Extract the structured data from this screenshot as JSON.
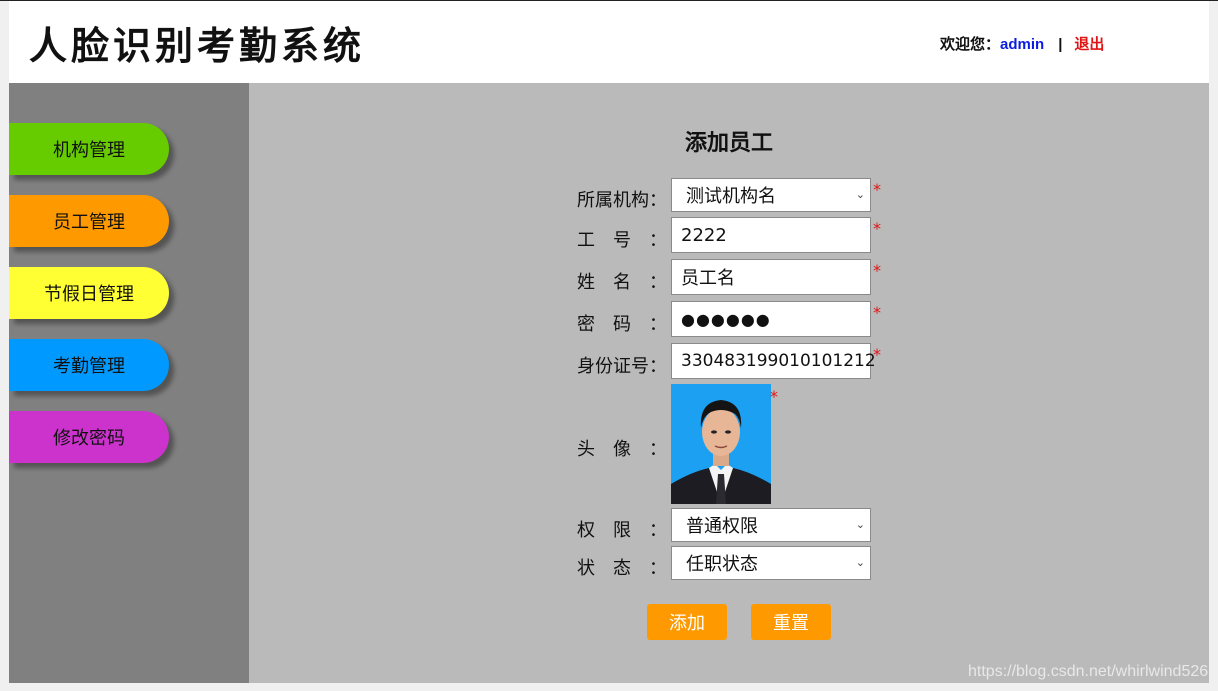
{
  "header": {
    "logo_text": "人脸识别考勤系统",
    "welcome": "欢迎您：",
    "username": "admin",
    "separator": "|",
    "logout": "退出"
  },
  "sidebar": {
    "items": [
      {
        "label": "机构管理",
        "color": "#66cc00"
      },
      {
        "label": "员工管理",
        "color": "#ff9900"
      },
      {
        "label": "节假日管理",
        "color": "#ffff33"
      },
      {
        "label": "考勤管理",
        "color": "#0099ff"
      },
      {
        "label": "修改密码",
        "color": "#cc33cc"
      }
    ]
  },
  "form": {
    "title": "添加员工",
    "org_label": "所属机构：",
    "org_value": "测试机构名",
    "empno_label": "工号：",
    "empno_value": "2222",
    "name_label": "姓名：",
    "name_value": "员工名",
    "password_label": "密码：",
    "password_value": "●●●●●●",
    "idcard_label": "身份证号：",
    "idcard_value": "330483199010101212",
    "avatar_label": "头像：",
    "permission_label": "权限：",
    "permission_value": "普通权限",
    "status_label": "状态：",
    "status_value": "任职状态",
    "required_mark": "*",
    "add_button": "添加",
    "reset_button": "重置"
  },
  "watermark": "https://blog.csdn.net/whirlwind526"
}
